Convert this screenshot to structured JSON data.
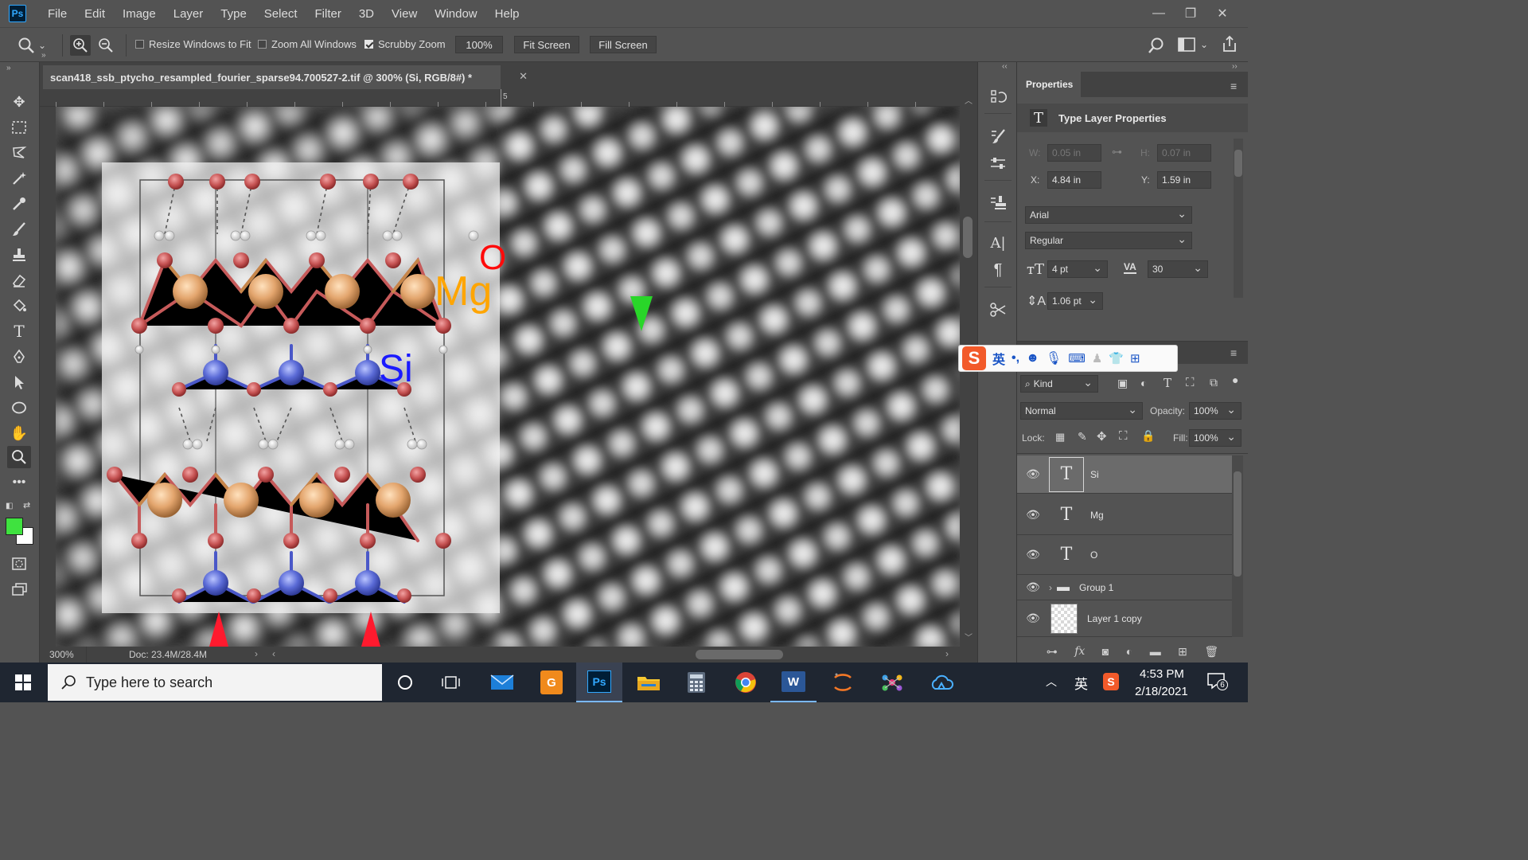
{
  "menubar": {
    "logo": "Ps",
    "items": [
      "File",
      "Edit",
      "Image",
      "Layer",
      "Type",
      "Select",
      "Filter",
      "3D",
      "View",
      "Window",
      "Help"
    ]
  },
  "options": {
    "resize_windows": "Resize Windows to Fit",
    "zoom_all": "Zoom All Windows",
    "scrubby_zoom": "Scrubby Zoom",
    "zoom_value": "100%",
    "fit_screen": "Fit Screen",
    "fill_screen": "Fill Screen"
  },
  "document": {
    "tab_title": "scan418_ssb_ptycho_resampled_fourier_sparse94.700527-2.tif @ 300% (Si, RGB/8#) *",
    "ruler_mark": "5",
    "zoom": "300%",
    "doc_info": "Doc: 23.4M/28.4M",
    "labels": {
      "o": "O",
      "mg": "Mg",
      "si": "Si"
    }
  },
  "properties": {
    "tab": "Properties",
    "section_title": "Type Layer Properties",
    "w_label": "W:",
    "w_value": "0.05 in",
    "h_label": "H:",
    "h_value": "0.07 in",
    "x_label": "X:",
    "x_value": "4.84 in",
    "y_label": "Y:",
    "y_value": "1.59 in",
    "font_family": "Arial",
    "font_style": "Regular",
    "font_size": "4 pt",
    "tracking": "30",
    "leading": "1.06 pt"
  },
  "ime": {
    "mode": "英"
  },
  "layers": {
    "filter_kind": "Kind",
    "blend_mode": "Normal",
    "opacity_label": "Opacity:",
    "opacity_value": "100%",
    "lock_label": "Lock:",
    "fill_label": "Fill:",
    "fill_value": "100%",
    "items": [
      {
        "name": "Si",
        "type": "text"
      },
      {
        "name": "Mg",
        "type": "text"
      },
      {
        "name": "O",
        "type": "text"
      },
      {
        "name": "Group 1",
        "type": "group"
      },
      {
        "name": "Layer 1 copy",
        "type": "pixel"
      }
    ]
  },
  "taskbar": {
    "search_placeholder": "Type here to search",
    "time": "4:53 PM",
    "date": "2/18/2021",
    "ime_lang": "英",
    "notif_count": "6"
  }
}
